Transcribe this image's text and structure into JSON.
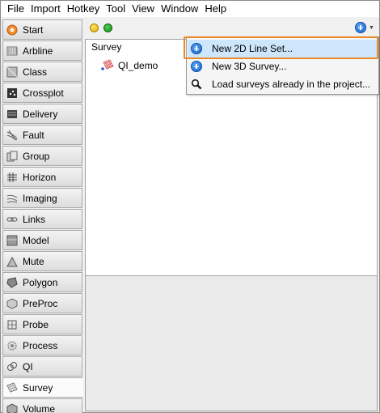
{
  "menubar": {
    "items": [
      "File",
      "Import",
      "Hotkey",
      "Tool",
      "View",
      "Window",
      "Help"
    ]
  },
  "sidebar": {
    "items": [
      {
        "label": "Start",
        "icon": "start-icon"
      },
      {
        "label": "Arbline",
        "icon": "arbline-icon"
      },
      {
        "label": "Class",
        "icon": "class-icon"
      },
      {
        "label": "Crossplot",
        "icon": "crossplot-icon"
      },
      {
        "label": "Delivery",
        "icon": "delivery-icon"
      },
      {
        "label": "Fault",
        "icon": "fault-icon"
      },
      {
        "label": "Group",
        "icon": "group-icon"
      },
      {
        "label": "Horizon",
        "icon": "horizon-icon"
      },
      {
        "label": "Imaging",
        "icon": "imaging-icon"
      },
      {
        "label": "Links",
        "icon": "links-icon"
      },
      {
        "label": "Model",
        "icon": "model-icon"
      },
      {
        "label": "Mute",
        "icon": "mute-icon"
      },
      {
        "label": "Polygon",
        "icon": "polygon-icon"
      },
      {
        "label": "PreProc",
        "icon": "preproc-icon"
      },
      {
        "label": "Probe",
        "icon": "probe-icon"
      },
      {
        "label": "Process",
        "icon": "process-icon"
      },
      {
        "label": "QI",
        "icon": "qi-icon"
      },
      {
        "label": "Survey",
        "icon": "survey-icon",
        "active": true
      },
      {
        "label": "Volume",
        "icon": "volume-icon"
      }
    ]
  },
  "main": {
    "panel_header": "Survey",
    "tree": [
      {
        "label": "QI_demo",
        "icon": "survey-grid-icon"
      }
    ]
  },
  "popup": {
    "items": [
      {
        "label": "New 2D Line Set...",
        "icon": "add-circle-icon",
        "highlighted": true
      },
      {
        "label": "New 3D Survey...",
        "icon": "add-circle-icon"
      },
      {
        "label": "Load surveys already in the project...",
        "icon": "magnifier-icon"
      }
    ]
  },
  "colors": {
    "highlight_frame": "#e98a2a",
    "highlight_fill": "#cde6fb",
    "status_yellow": "#f2c200",
    "status_green": "#22a822",
    "add_blue": "#1f74d8"
  }
}
